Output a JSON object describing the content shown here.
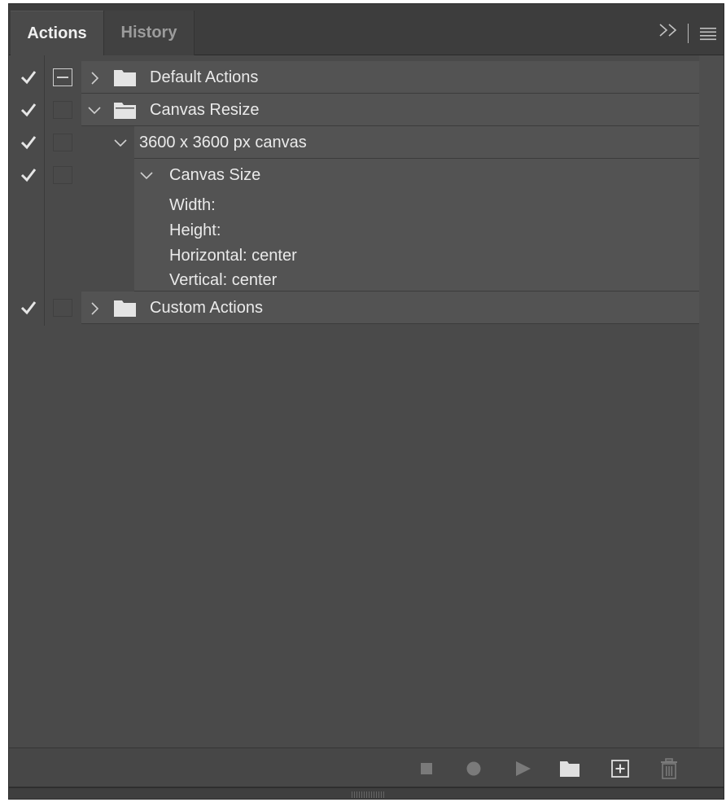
{
  "tabs": [
    {
      "label": "Actions",
      "active": true
    },
    {
      "label": "History",
      "active": false
    }
  ],
  "header_icons": [
    "collapse-double-chevron-icon",
    "panel-menu-icon"
  ],
  "rows": [
    {
      "label": "Default Actions",
      "type": "set",
      "expanded": false,
      "checked": true,
      "dialog": "toggle-set"
    },
    {
      "label": "Canvas Resize",
      "type": "set",
      "expanded": true,
      "checked": true,
      "dialog": "off"
    },
    {
      "label": "3600 x 3600 px canvas",
      "type": "action",
      "expanded": true,
      "checked": true,
      "dialog": "off"
    },
    {
      "label": "Canvas Size",
      "type": "command",
      "expanded": true,
      "checked": true,
      "dialog": "off"
    },
    {
      "label": "Custom Actions",
      "type": "set",
      "expanded": false,
      "checked": true,
      "dialog": "off"
    }
  ],
  "details": [
    "Width:",
    "Height:",
    "Horizontal: center",
    "Vertical: center"
  ],
  "footer_icons": [
    "stop-icon",
    "record-icon",
    "play-icon",
    "new-set-folder-icon",
    "new-action-icon",
    "delete-icon"
  ],
  "colors": {
    "panel_bg": "#4a4a4a",
    "row_bg": "#535353",
    "text": "#eaeaea",
    "icon_disabled": "#7a7a7a"
  }
}
